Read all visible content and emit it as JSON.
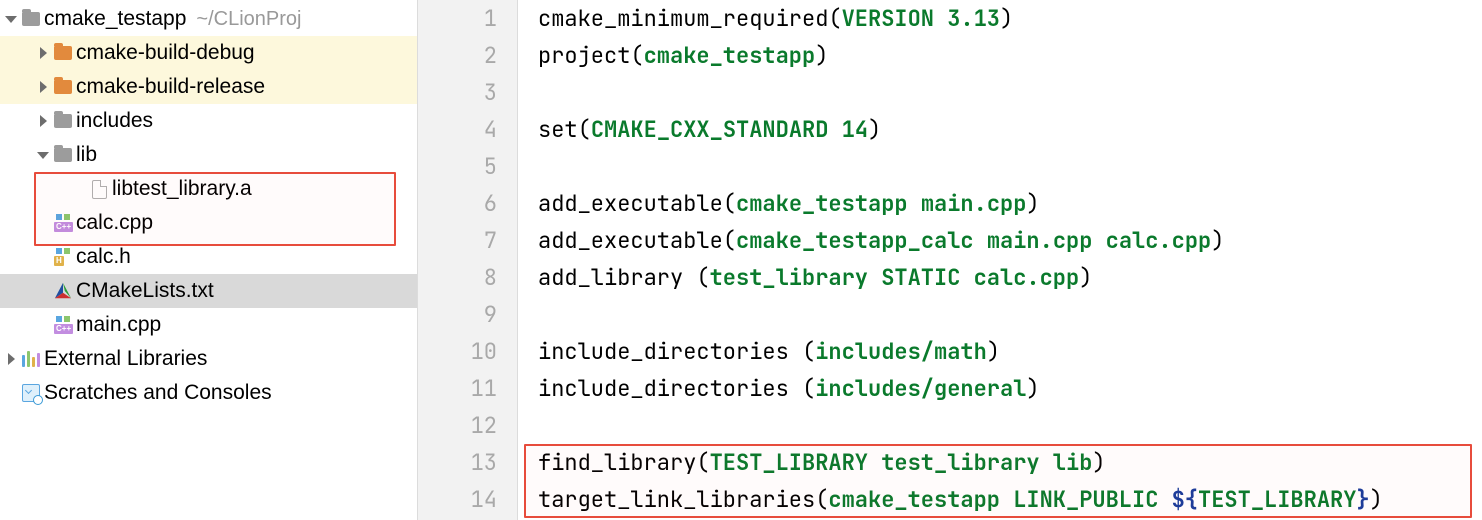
{
  "tree": {
    "root": {
      "name": "cmake_testapp",
      "path": "~/CLionProj"
    },
    "build_debug": "cmake-build-debug",
    "build_release": "cmake-build-release",
    "includes": "includes",
    "lib": "lib",
    "lib_file": "libtest_library.a",
    "calc_cpp": "calc.cpp",
    "calc_h": "calc.h",
    "cmakelists": "CMakeLists.txt",
    "main_cpp": "main.cpp",
    "ext_libs": "External Libraries",
    "scratches": "Scratches and Consoles"
  },
  "code": {
    "lines": [
      {
        "fn": "cmake_minimum_required",
        "args": [
          {
            "t": "VERSION 3.13",
            "c": "kw"
          }
        ]
      },
      {
        "fn": "project",
        "args": [
          {
            "t": "cmake_testapp",
            "c": "kw"
          }
        ]
      },
      null,
      {
        "fn": "set",
        "args": [
          {
            "t": "CMAKE_CXX_STANDARD 14",
            "c": "kw"
          }
        ]
      },
      null,
      {
        "fn": "add_executable",
        "args": [
          {
            "t": "cmake_testapp main.cpp",
            "c": "kw"
          }
        ]
      },
      {
        "fn": "add_executable",
        "args": [
          {
            "t": "cmake_testapp_calc main.cpp calc.cpp",
            "c": "kw"
          }
        ]
      },
      {
        "fn": "add_library",
        "sp": " ",
        "args": [
          {
            "t": "test_library STATIC calc.cpp",
            "c": "kw"
          }
        ]
      },
      null,
      {
        "fn": "include_directories",
        "sp": " ",
        "args": [
          {
            "t": "includes/math",
            "c": "kw"
          }
        ]
      },
      {
        "fn": "include_directories",
        "sp": " ",
        "args": [
          {
            "t": "includes/general",
            "c": "kw"
          }
        ]
      },
      null,
      {
        "fn": "find_library",
        "args": [
          {
            "t": "TEST_LIBRARY test_library lib",
            "c": "kw"
          }
        ]
      },
      {
        "fn": "target_link_libraries",
        "args": [
          {
            "t": "cmake_testapp LINK_PUBLIC ",
            "c": "kw"
          },
          {
            "t": "${",
            "c": "vr"
          },
          {
            "t": "TEST_LIBRARY",
            "c": "kw"
          },
          {
            "t": "}",
            "c": "vr"
          }
        ]
      }
    ]
  }
}
